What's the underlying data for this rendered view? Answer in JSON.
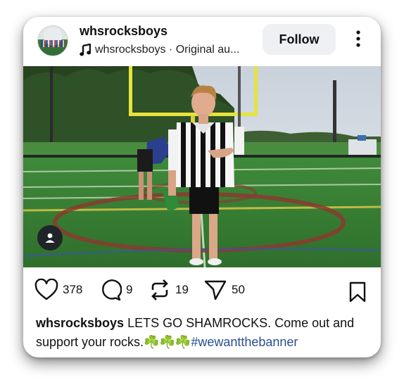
{
  "post": {
    "username": "whsrocksboys",
    "audio_label": "whsrocksboys · Original au...",
    "follow_label": "Follow"
  },
  "actions": {
    "likes": "378",
    "comments": "9",
    "reposts": "19",
    "shares": "50"
  },
  "caption": {
    "username": "whsrocksboys",
    "text": "LETS GO SHAMROCKS. Come out and support your rocks.☘️☘️☘️",
    "hashtag": "#wewantthebanner"
  },
  "icons": [
    "music-icon",
    "more-icon",
    "person-icon",
    "heart-icon",
    "comment-icon",
    "repost-icon",
    "share-icon",
    "bookmark-icon"
  ]
}
